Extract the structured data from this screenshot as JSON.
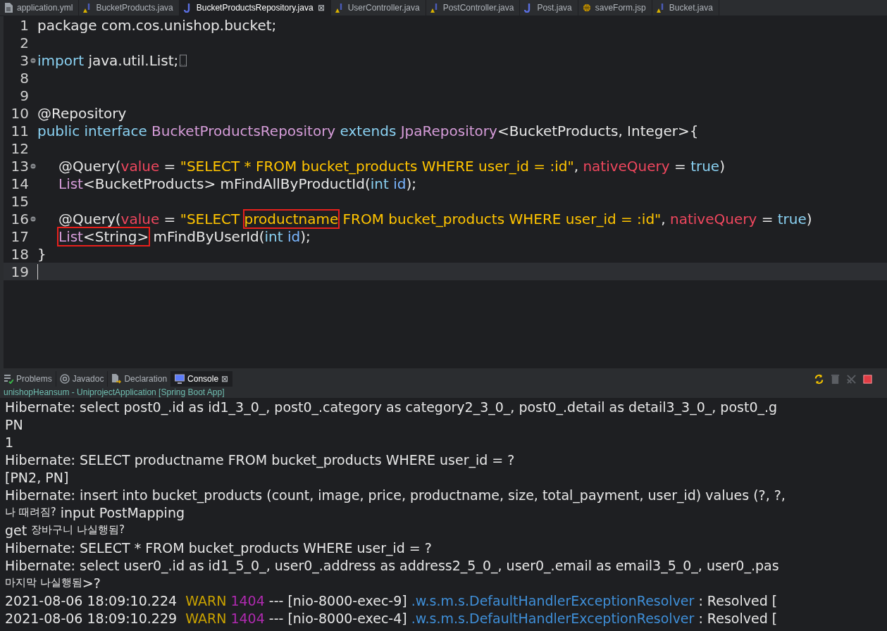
{
  "editor_tabs": [
    {
      "label": "application.yml",
      "kind": "file",
      "selected": false
    },
    {
      "label": "BucketProducts.java",
      "kind": "java-warn",
      "selected": false
    },
    {
      "label": "BucketProductsRepository.java",
      "kind": "java",
      "selected": true,
      "close": "⊠"
    },
    {
      "label": "UserController.java",
      "kind": "java-warn",
      "selected": false
    },
    {
      "label": "PostController.java",
      "kind": "java-warn",
      "selected": false
    },
    {
      "label": "Post.java",
      "kind": "java",
      "selected": false
    },
    {
      "label": "saveForm.jsp",
      "kind": "globe",
      "selected": false
    },
    {
      "label": "Bucket.java",
      "kind": "java-warn",
      "selected": false
    }
  ],
  "code_lines": [
    {
      "number": "1",
      "tokens": [
        {
          "kind": "plain",
          "text": "package com.cos.unishop.bucket;"
        }
      ]
    },
    {
      "number": "2"
    },
    {
      "number": "3",
      "fold": true,
      "folded": true,
      "tokens": [
        {
          "kind": "kw",
          "text": "import"
        },
        {
          "kind": "plain",
          "text": " java.util.List;"
        }
      ]
    },
    {
      "number": "8"
    },
    {
      "number": "9"
    },
    {
      "number": "10",
      "tokens": [
        {
          "kind": "plain",
          "text": "@Repository"
        }
      ]
    },
    {
      "number": "11",
      "tokens": [
        {
          "kind": "kw",
          "text": "public interface "
        },
        {
          "kind": "type",
          "text": "BucketProductsRepository"
        },
        {
          "kind": "kw",
          "text": " extends "
        },
        {
          "kind": "type",
          "text": "JpaRepository"
        },
        {
          "kind": "plain",
          "text": "<BucketProducts, Integer>{"
        }
      ],
      "children": [
        {
          "number": "12"
        },
        {
          "number": "13",
          "fold": true,
          "tokens": [
            {
              "kind": "plain",
              "text": "@Query("
            },
            {
              "kind": "attr",
              "text": "value"
            },
            {
              "kind": "plain",
              "text": " = "
            },
            {
              "kind": "str",
              "text": "\"SELECT * FROM bucket_products WHERE user_id = :id\""
            },
            {
              "kind": "plain",
              "text": ", "
            },
            {
              "kind": "attr",
              "text": "nativeQuery"
            },
            {
              "kind": "plain",
              "text": " = "
            },
            {
              "kind": "kw",
              "text": "true"
            },
            {
              "kind": "plain",
              "text": ")"
            }
          ]
        },
        {
          "number": "14",
          "tokens": [
            {
              "kind": "type",
              "text": "List"
            },
            {
              "kind": "plain",
              "text": "<BucketProducts> mFindAllByProductId("
            },
            {
              "kind": "kw",
              "text": "int"
            },
            {
              "kind": "var",
              "text": " id"
            },
            {
              "kind": "plain",
              "text": ");"
            }
          ]
        },
        {
          "number": "15"
        },
        {
          "number": "16",
          "fold": true,
          "tokens": [
            {
              "kind": "plain",
              "text": "@Query("
            },
            {
              "kind": "attr",
              "text": "value"
            },
            {
              "kind": "plain",
              "text": " = "
            },
            {
              "kind": "str",
              "text": "\"SELECT "
            },
            {
              "boxed": true,
              "parts": [
                {
                  "kind": "str",
                  "text": "productname"
                }
              ]
            },
            {
              "kind": "str",
              "text": " FROM bucket_products WHERE user_id = :id\""
            },
            {
              "kind": "plain",
              "text": ", "
            },
            {
              "kind": "attr",
              "text": "nativeQuery"
            },
            {
              "kind": "plain",
              "text": " = "
            },
            {
              "kind": "kw",
              "text": "true"
            },
            {
              "kind": "plain",
              "text": ")"
            }
          ]
        },
        {
          "number": "17",
          "tokens": [
            {
              "boxed": true,
              "parts": [
                {
                  "kind": "type",
                  "text": "List"
                },
                {
                  "kind": "plain",
                  "text": "<String>"
                }
              ]
            },
            {
              "kind": "plain",
              "text": " mFindByUserId("
            },
            {
              "kind": "kw",
              "text": "int"
            },
            {
              "kind": "var",
              "text": " id"
            },
            {
              "kind": "plain",
              "text": ");"
            }
          ]
        }
      ]
    },
    {
      "number": "18",
      "tokens": [
        {
          "kind": "plain",
          "text": "}"
        }
      ]
    },
    {
      "number": "19",
      "current": true
    }
  ],
  "panel_tabs": [
    {
      "label": "Problems",
      "kind": "problems",
      "selected": false
    },
    {
      "label": "Javadoc",
      "kind": "at",
      "selected": false
    },
    {
      "label": "Declaration",
      "kind": "decl",
      "selected": false
    },
    {
      "label": "Console",
      "kind": "monitor",
      "selected": true,
      "close": "⊠"
    }
  ],
  "console_title": "unishopHeansum - UniprojectApplication [Spring Boot App]",
  "console_lines": [
    [
      {
        "kind": "plain",
        "text": "Hibernate: select post0_.id as id1_3_0_, post0_.category as category2_3_0_, post0_.detail as detail3_3_0_, post0_.g"
      }
    ],
    [
      {
        "kind": "plain",
        "text": "PN"
      }
    ],
    [
      {
        "kind": "plain",
        "text": "1"
      }
    ],
    [
      {
        "kind": "plain",
        "text": "Hibernate: SELECT productname FROM bucket_products WHERE user_id = ?"
      }
    ],
    [
      {
        "kind": "plain",
        "text": "[PN2, PN]"
      }
    ],
    [
      {
        "kind": "plain",
        "text": "Hibernate: insert into bucket_products (count, image, price, productname, size, total_payment, user_id) values (?, ?,"
      }
    ],
    [
      {
        "kind": "ko",
        "text": "나 때려짐?"
      },
      {
        "kind": "plain",
        "text": " input PostMapping"
      }
    ],
    [
      {
        "kind": "plain",
        "text": "get "
      },
      {
        "kind": "ko",
        "text": "장바구니 나실행됨?"
      }
    ],
    [
      {
        "kind": "plain",
        "text": "Hibernate: SELECT * FROM bucket_products WHERE user_id = ?"
      }
    ],
    [
      {
        "kind": "plain",
        "text": "Hibernate: select user0_.id as id1_5_0_, user0_.address as address2_5_0_, user0_.email as email3_5_0_, user0_.pas"
      }
    ],
    [
      {
        "kind": "ko",
        "text": "마지막 나실행됨"
      },
      {
        "kind": "plain",
        "text": ">?"
      }
    ],
    [
      {
        "kind": "plain",
        "text": "2021-08-06 18:09:10.224  "
      },
      {
        "kind": "warn",
        "text": "WARN"
      },
      {
        "kind": "pid",
        "text": " 1404"
      },
      {
        "kind": "plain",
        "text": " --- [nio-8000-exec-9] "
      },
      {
        "kind": "cls",
        "text": ".w.s.m.s.DefaultHandlerExceptionResolver"
      },
      {
        "kind": "plain",
        "text": " : Resolved ["
      }
    ],
    [
      {
        "kind": "plain",
        "text": "2021-08-06 18:09:10.229  "
      },
      {
        "kind": "warn",
        "text": "WARN"
      },
      {
        "kind": "pid",
        "text": " 1404"
      },
      {
        "kind": "plain",
        "text": " --- [nio-8000-exec-4] "
      },
      {
        "kind": "cls",
        "text": ".w.s.m.s.DefaultHandlerExceptionResolver"
      },
      {
        "kind": "plain",
        "text": " : Resolved ["
      }
    ]
  ]
}
